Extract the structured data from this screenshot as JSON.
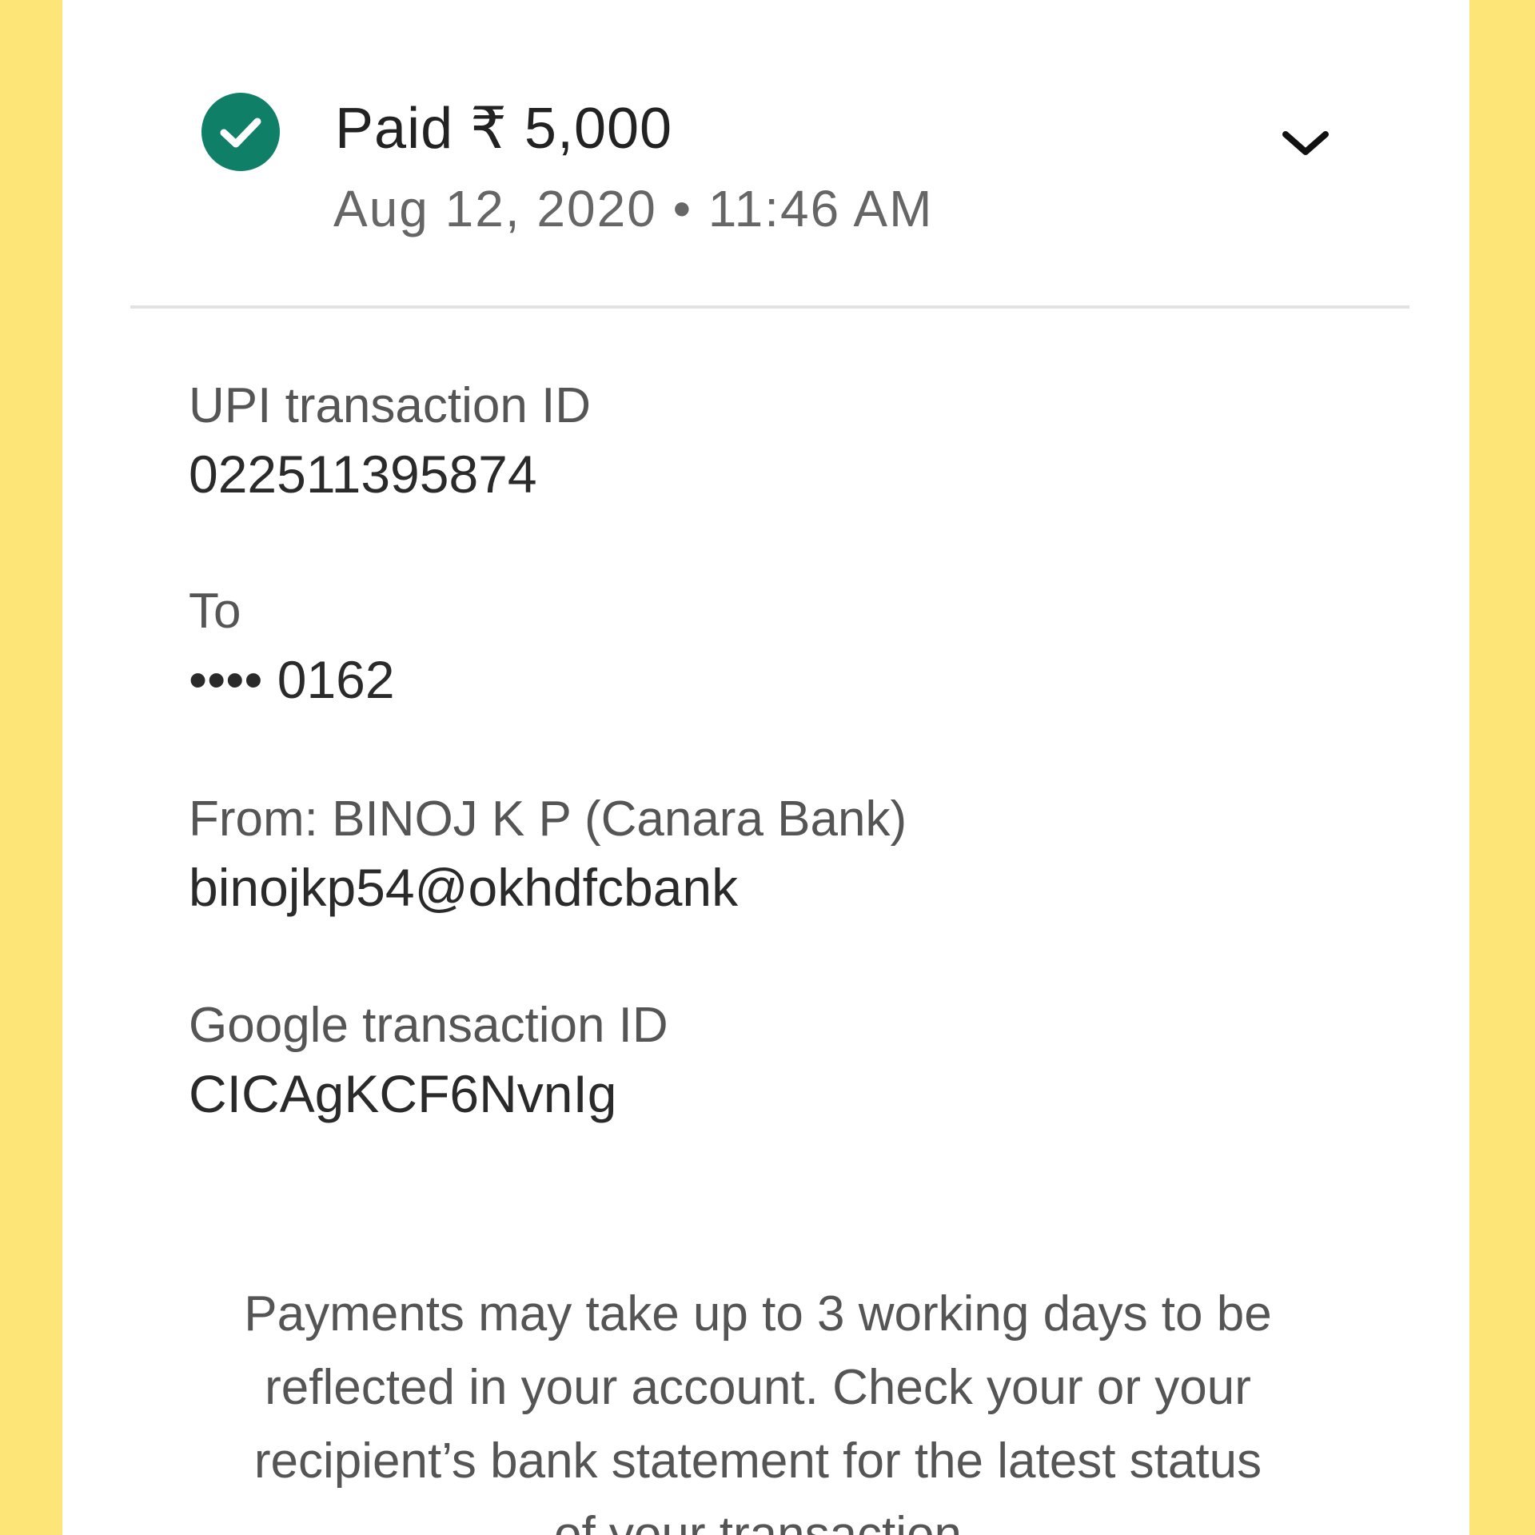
{
  "payment": {
    "status_icon": "check-circle-icon",
    "title": "Paid ₹ 5,000",
    "datetime": "Aug 12, 2020 • 11:46 AM",
    "expand_icon": "chevron-down-icon"
  },
  "details": {
    "upi_label": "UPI transaction ID",
    "upi_value": "022511395874",
    "to_label": "To",
    "to_value": "•••• 0162",
    "from_label": "From: BINOJ K P (Canara Bank)",
    "from_value": "binojkp54@okhdfcbank",
    "google_label": "Google transaction ID",
    "google_value": "CICAgKCF6NvnIg"
  },
  "notice": "Payments may take up to 3 working days to be reflected in your account. Check your or your recipient’s bank statement for the latest status of your transaction",
  "colors": {
    "background": "#fde577",
    "accent": "#0f7f68"
  }
}
